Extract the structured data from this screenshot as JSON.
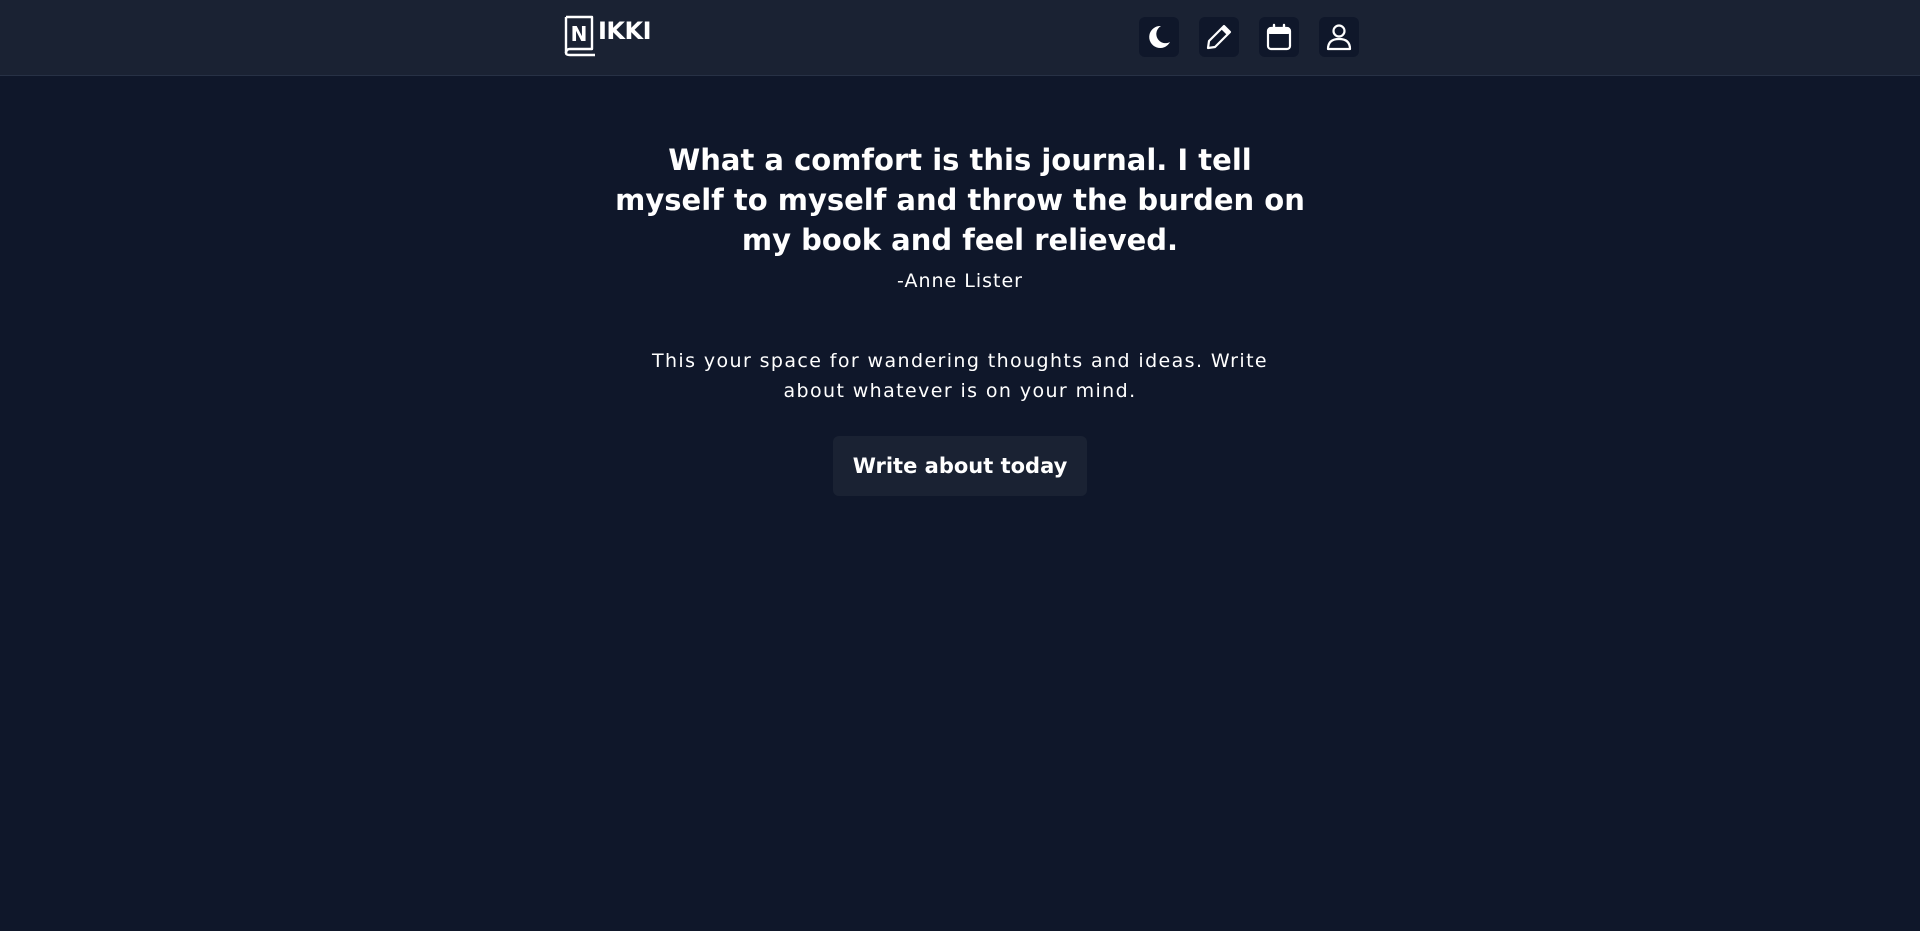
{
  "app": {
    "logo_letter": "N",
    "logo_text": "IKKI"
  },
  "nav": {
    "items": [
      {
        "icon": "moon-icon",
        "label": "Toggle theme"
      },
      {
        "icon": "pencil-icon",
        "label": "Write"
      },
      {
        "icon": "calendar-icon",
        "label": "Calendar"
      },
      {
        "icon": "user-icon",
        "label": "Profile"
      }
    ]
  },
  "hero": {
    "quote": "What a comfort is this journal. I tell myself to myself and throw the burden on my book and feel relieved.",
    "author": "-Anne Lister",
    "intro": "This your space for wandering thoughts and ideas. Write about whatever is on your mind.",
    "cta_label": "Write about today"
  },
  "colors": {
    "background": "#0f172a",
    "header": "#1a2233",
    "text": "#ffffff"
  }
}
